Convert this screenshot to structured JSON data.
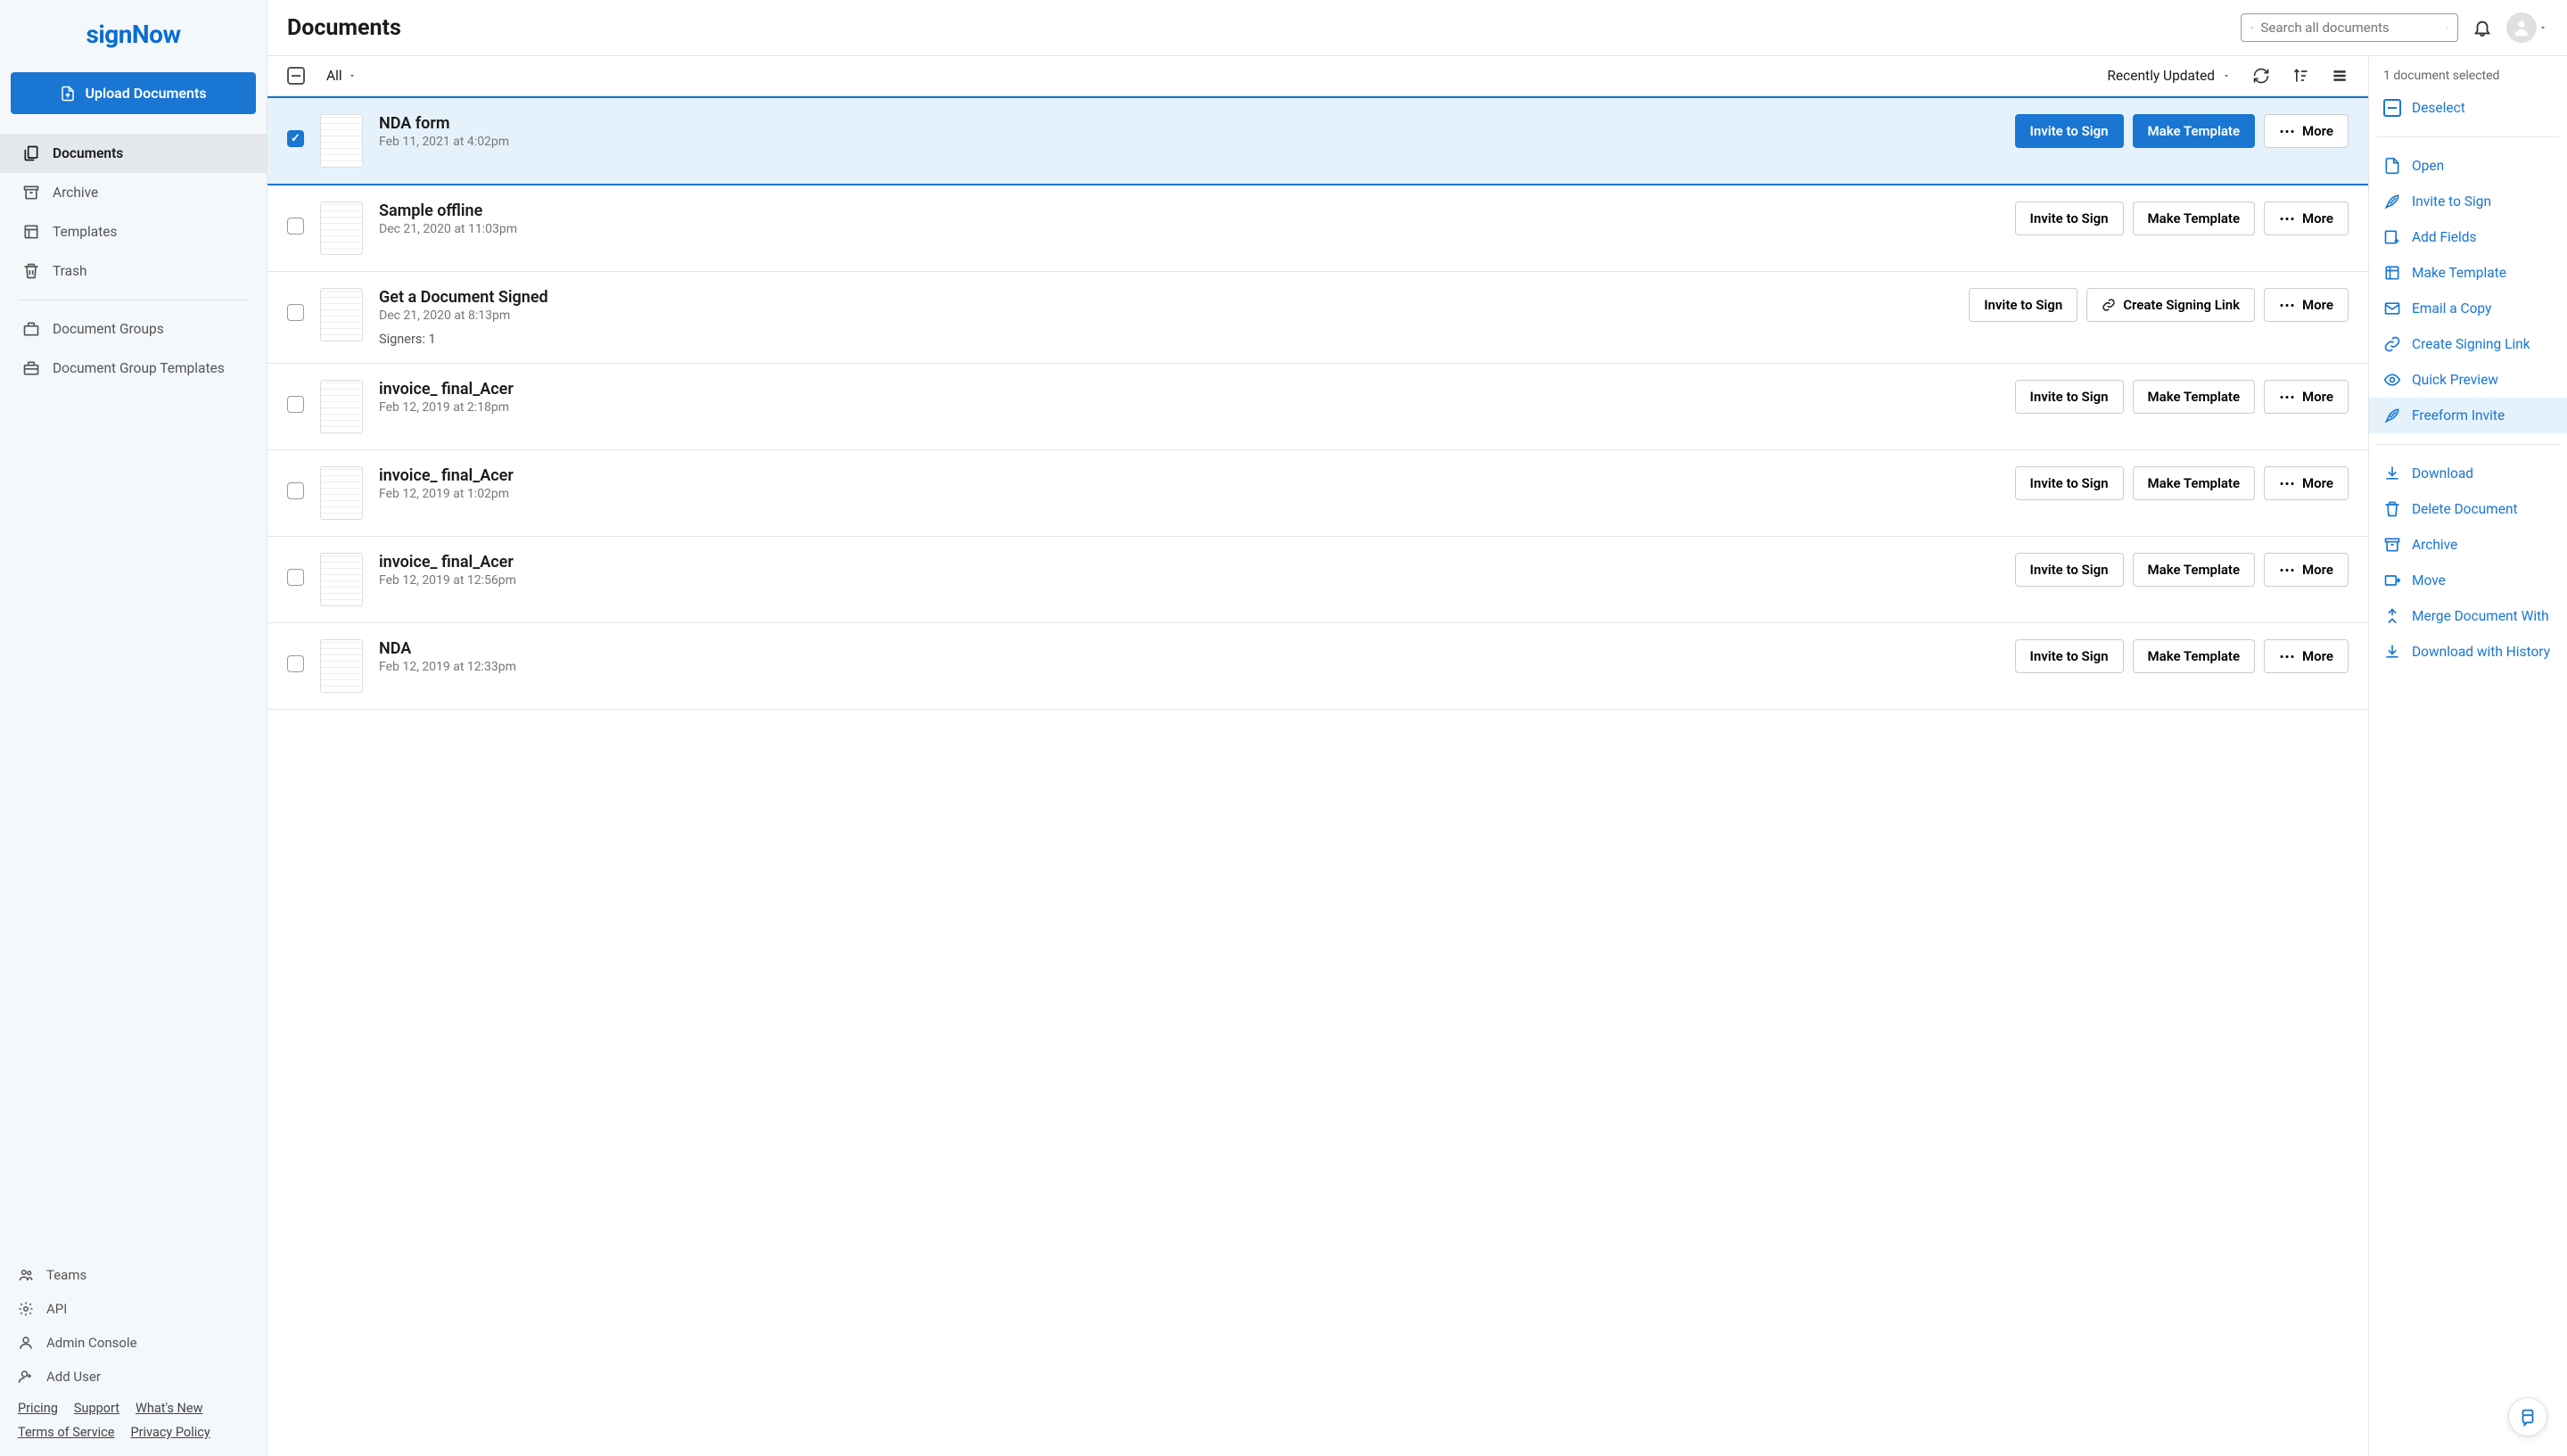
{
  "brand": "signNow",
  "upload_label": "Upload Documents",
  "nav": {
    "documents": "Documents",
    "archive": "Archive",
    "templates": "Templates",
    "trash": "Trash",
    "doc_groups": "Document Groups",
    "doc_group_templates": "Document Group Templates"
  },
  "bottom_nav": {
    "teams": "Teams",
    "api": "API",
    "admin_console": "Admin Console",
    "add_user": "Add User"
  },
  "footer_links": {
    "pricing": "Pricing",
    "support": "Support",
    "whats_new": "What's New",
    "terms": "Terms of Service",
    "privacy": "Privacy Policy"
  },
  "header": {
    "title": "Documents",
    "search_placeholder": "Search all documents"
  },
  "toolbar": {
    "filter": "All",
    "sort": "Recently Updated"
  },
  "buttons": {
    "invite_to_sign": "Invite to Sign",
    "make_template": "Make Template",
    "create_signing_link": "Create Signing Link",
    "more": "More"
  },
  "docs": [
    {
      "title": "NDA form",
      "date": "Feb 11, 2021 at 4:02pm",
      "selected": true,
      "action2": "make_template"
    },
    {
      "title": "Sample offline",
      "date": "Dec 21, 2020 at 11:03pm",
      "selected": false,
      "action2": "make_template"
    },
    {
      "title": "Get a Document Signed",
      "date": "Dec 21, 2020 at 8:13pm",
      "selected": false,
      "action2": "signing_link",
      "signers": "Signers: 1"
    },
    {
      "title": "invoice_ final_Acer",
      "date": "Feb 12, 2019 at 2:18pm",
      "selected": false,
      "action2": "make_template"
    },
    {
      "title": "invoice_ final_Acer",
      "date": "Feb 12, 2019 at 1:02pm",
      "selected": false,
      "action2": "make_template"
    },
    {
      "title": "invoice_ final_Acer",
      "date": "Feb 12, 2019 at 12:56pm",
      "selected": false,
      "action2": "make_template"
    },
    {
      "title": "NDA",
      "date": "Feb 12, 2019 at 12:33pm",
      "selected": false,
      "action2": "make_template"
    }
  ],
  "right_panel": {
    "status": "1 document selected",
    "deselect": "Deselect",
    "open": "Open",
    "invite_to_sign": "Invite to Sign",
    "add_fields": "Add Fields",
    "make_template": "Make Template",
    "email_copy": "Email a Copy",
    "create_signing_link": "Create Signing Link",
    "quick_preview": "Quick Preview",
    "freeform_invite": "Freeform Invite",
    "download": "Download",
    "delete_document": "Delete Document",
    "archive": "Archive",
    "move": "Move",
    "merge": "Merge Document With",
    "download_history": "Download with History"
  }
}
